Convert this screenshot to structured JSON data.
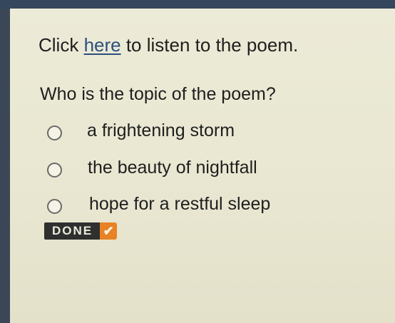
{
  "prompt": {
    "before": "Click ",
    "link": "here",
    "after": " to listen to the poem."
  },
  "question": "Who is the topic of the poem?",
  "options": [
    {
      "label": "a frightening storm",
      "selected": false
    },
    {
      "label": "the beauty of nightfall",
      "selected": false
    },
    {
      "label": "hope for a restful sleep",
      "selected": false
    }
  ],
  "done_button": {
    "label": "DONE",
    "icon": "checkmark-icon",
    "check_glyph": "✔"
  },
  "colors": {
    "link": "#2c4f7c",
    "done_accent": "#e78225",
    "done_background": "#2f2f2f"
  }
}
